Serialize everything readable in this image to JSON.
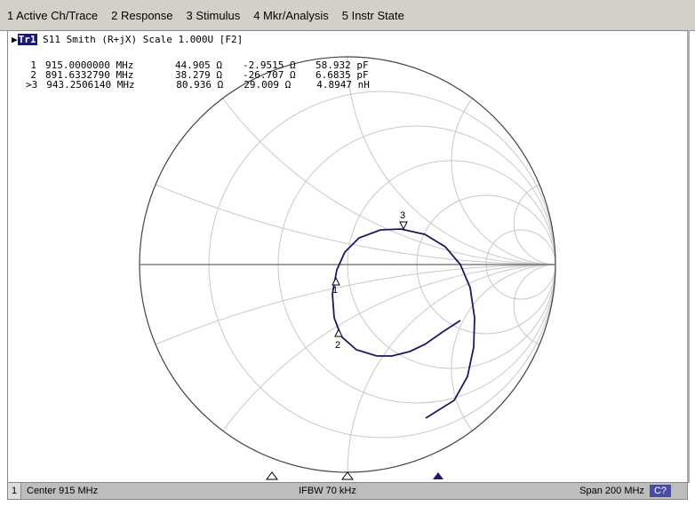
{
  "menu": [
    "1 Active Ch/Trace",
    "2 Response",
    "3 Stimulus",
    "4 Mkr/Analysis",
    "5 Instr State"
  ],
  "trace": {
    "name": "Tr1",
    "desc": "S11 Smith (R+jX) Scale 1.000U [F2]"
  },
  "markers": [
    {
      "id": "1",
      "freq": "915.0000000 MHz",
      "r": "44.905 Ω",
      "x": "-2.9515 Ω",
      "lc": "58.932 pF"
    },
    {
      "id": "2",
      "freq": "891.6332790 MHz",
      "r": "38.279 Ω",
      "x": "-26.707 Ω",
      "lc": "6.6835 pF"
    },
    {
      "id": ">3",
      "freq": "943.2506140 MHz",
      "r": "80.936 Ω",
      "x": "29.009 Ω",
      "lc": "4.8947 nH"
    }
  ],
  "marker_labels": [
    "1",
    "2",
    "3"
  ],
  "status": {
    "channel": "1",
    "center": "Center 915 MHz",
    "ifbw": "IFBW 70 kHz",
    "span": "Span 200 MHz",
    "cal": "C?"
  },
  "colors": {
    "trace": "#1a1a5e",
    "grid": "#c8c8c8",
    "active": "#1a1a6e"
  }
}
